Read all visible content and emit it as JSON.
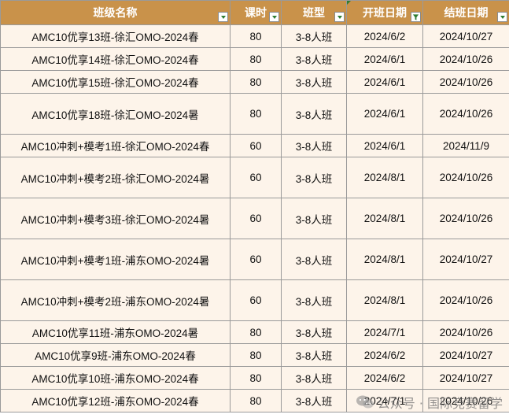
{
  "headers": [
    "班级名称",
    "课时",
    "班型",
    "开班日期",
    "结班日期"
  ],
  "rows": [
    [
      "AMC10优享13班-徐汇OMO-2024春",
      "80",
      "3-8人班",
      "2024/6/2",
      "2024/10/27"
    ],
    [
      "AMC10优享14班-徐汇OMO-2024春",
      "80",
      "3-8人班",
      "2024/6/1",
      "2024/10/26"
    ],
    [
      "AMC10优享15班-徐汇OMO-2024春",
      "80",
      "3-8人班",
      "2024/6/1",
      "2024/10/26"
    ],
    [
      "AMC10优享18班-徐汇OMO-2024暑",
      "80",
      "3-8人班",
      "2024/6/1",
      "2024/10/26"
    ],
    [
      "AMC10冲刺+模考1班-徐汇OMO-2024春",
      "60",
      "3-8人班",
      "2024/6/1",
      "2024/11/9"
    ],
    [
      "AMC10冲刺+模考2班-徐汇OMO-2024暑",
      "60",
      "3-8人班",
      "2024/8/1",
      "2024/10/26"
    ],
    [
      "AMC10冲刺+模考3班-徐汇OMO-2024暑",
      "60",
      "3-8人班",
      "2024/8/1",
      "2024/10/26"
    ],
    [
      "AMC10冲刺+模考1班-浦东OMO-2024暑",
      "60",
      "3-8人班",
      "2024/8/1",
      "2024/10/27"
    ],
    [
      "AMC10冲刺+模考2班-浦东OMO-2024暑",
      "60",
      "3-8人班",
      "2024/8/1",
      "2024/10/26"
    ],
    [
      "AMC10优享11班-浦东OMO-2024暑",
      "80",
      "3-8人班",
      "2024/7/1",
      "2024/10/26"
    ],
    [
      "AMC10优享9班-浦东OMO-2024春",
      "80",
      "3-8人班",
      "2024/6/2",
      "2024/10/27"
    ],
    [
      "AMC10优享10班-浦东OMO-2024春",
      "80",
      "3-8人班",
      "2024/6/2",
      "2024/10/27"
    ],
    [
      "AMC10优享12班-浦东OMO-2024春",
      "80",
      "3-8人班",
      "2024/7/1",
      "2024/10/26"
    ]
  ],
  "colors": {
    "header_bg": "#c9924a",
    "header_text": "#ffffff",
    "row_bg": "#fdf4ea",
    "grid": "#9a9a9a",
    "filter_accent": "#2e7d32"
  },
  "watermark": {
    "text": "公众号 · 国际竞赛留学",
    "icon": "wechat-icon"
  }
}
